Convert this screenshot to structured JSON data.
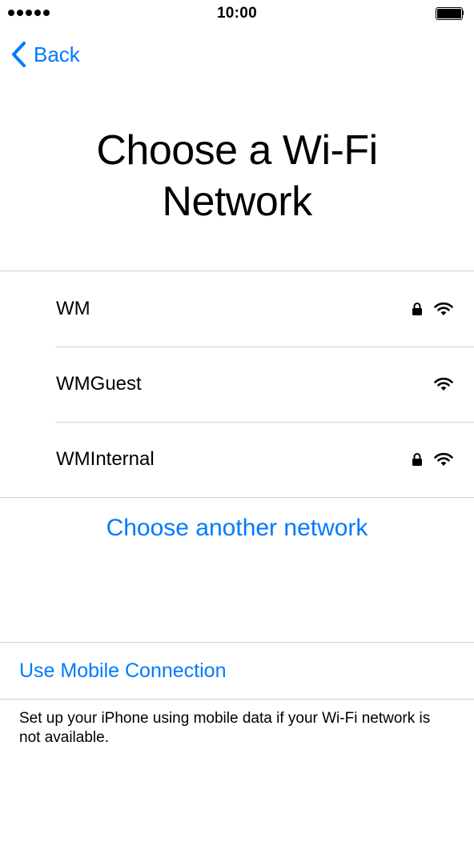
{
  "status_bar": {
    "time": "10:00",
    "signal_dots": 5,
    "battery_level": 1.0
  },
  "nav": {
    "back_label": "Back",
    "back_icon": "chevron-left-icon"
  },
  "title": {
    "line1": "Choose a Wi-Fi",
    "line2": "Network"
  },
  "networks": [
    {
      "name": "WM",
      "secured": true,
      "icons": [
        "lock-icon",
        "wifi-icon"
      ]
    },
    {
      "name": "WMGuest",
      "secured": false,
      "icons": [
        "wifi-icon"
      ]
    },
    {
      "name": "WMInternal",
      "secured": true,
      "icons": [
        "lock-icon",
        "wifi-icon"
      ]
    }
  ],
  "choose_another_label": "Choose another network",
  "mobile": {
    "link_label": "Use Mobile Connection",
    "description": "Set up your iPhone using mobile data if your Wi-Fi network is not available."
  },
  "colors": {
    "accent": "#007aff",
    "separator": "#d1d1d6",
    "text": "#000000",
    "background": "#ffffff"
  }
}
